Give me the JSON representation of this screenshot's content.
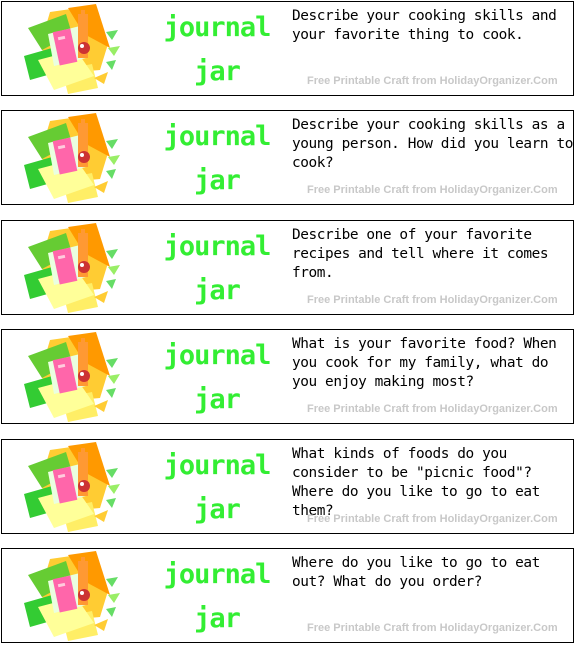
{
  "colors": {
    "title_green": "#33ee33",
    "credit_gray": "#c8c8c8"
  },
  "cards": [
    {
      "title_line1": "journal",
      "title_line2": "jar",
      "prompt": "Describe your cooking skills and your favorite thing to cook.",
      "credit": "Free Printable Craft from HolidayOrganizer.Com",
      "icon": "cooking-clipart-icon"
    },
    {
      "title_line1": "journal",
      "title_line2": "jar",
      "prompt": "Describe your cooking skills as a young person. How did you learn to cook?",
      "credit": "Free Printable Craft from HolidayOrganizer.Com",
      "icon": "cooking-clipart-icon"
    },
    {
      "title_line1": "journal",
      "title_line2": "jar",
      "prompt": "Describe one of your favorite recipes and tell where it comes from.",
      "credit": "Free Printable Craft from HolidayOrganizer.Com",
      "icon": "cooking-clipart-icon"
    },
    {
      "title_line1": "journal",
      "title_line2": "jar",
      "prompt": "What is your favorite food? When you cook for my family, what do you enjoy making most?",
      "credit": "Free Printable Craft from HolidayOrganizer.Com",
      "icon": "cooking-clipart-icon"
    },
    {
      "title_line1": "journal",
      "title_line2": "jar",
      "prompt": "What kinds of foods do you consider to be \"picnic food\"? Where do you like to go to eat them?",
      "credit": "Free Printable Craft from HolidayOrganizer.Com",
      "icon": "cooking-clipart-icon"
    },
    {
      "title_line1": "journal",
      "title_line2": "jar",
      "prompt": "Where do you like to go to eat out? What do you order?",
      "credit": "Free Printable Craft from HolidayOrganizer.Com",
      "icon": "cooking-clipart-icon"
    }
  ]
}
